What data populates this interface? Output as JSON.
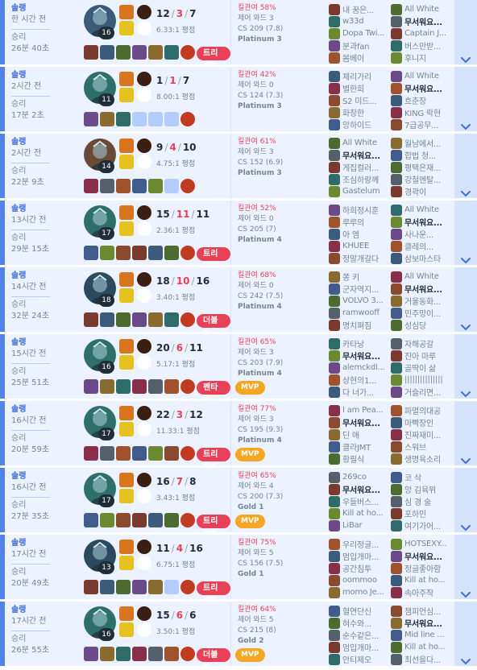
{
  "colors": {
    "win_bg": "#ecf2ff",
    "win_accent": "#5383e8",
    "loss_kda": "#e84057",
    "expand_bg": "#d5e3ff",
    "kill_badge": "#e84057",
    "mvp_badge": "#f5a623"
  },
  "icons": {
    "expand": "chevron-down-icon",
    "spell": "summoner-spell-icon",
    "rune": "rune-icon",
    "item": "item-icon",
    "ward": "trinket-icon",
    "champion": "champion-portrait"
  },
  "matches": [
    {
      "queue": "솔랭",
      "ago": "한 시간 전",
      "result": "승리",
      "length": "26분 40초",
      "level": "16",
      "k": "12",
      "d": "3",
      "a": "7",
      "ratio": "6.33:1 평점",
      "kp": "킬관여 58%",
      "wards": "제어 와드 3",
      "cs": "CS 209 (7.8)",
      "tier": "Platinum 3",
      "badge": "트리플킬",
      "mvp": "",
      "champ_color": "#3b5b7a",
      "empty_items": 0,
      "team1": [
        "내 꿈은...",
        "w33d",
        "Dopa Twi...",
        "분과fan",
        "봄베이"
      ],
      "team2": [
        "All White",
        "무서워요...",
        "Captain J...",
        "버스만받...",
        "후니지"
      ],
      "me_side": 2,
      "me_index": 1
    },
    {
      "queue": "솔랭",
      "ago": "2시간 전",
      "result": "승리",
      "length": "17분 2초",
      "level": "11",
      "k": "1",
      "d": "1",
      "a": "7",
      "ratio": "8.00:1 평점",
      "kp": "킬관여 42%",
      "wards": "제어 와드 0",
      "cs": "CS 124 (7.3)",
      "tier": "Platinum 3",
      "badge": "",
      "mvp": "",
      "champ_color": "#2f6f6a",
      "empty_items": 3,
      "team1": [
        "제리가리",
        "별한희",
        "S2 미드...",
        "화창한",
        "앙하이드"
      ],
      "team2": [
        "All White",
        "무서워요...",
        "흐춘장",
        "KING 락현",
        "7급공무..."
      ],
      "me_side": 2,
      "me_index": 1
    },
    {
      "queue": "솔랭",
      "ago": "2시간 전",
      "result": "승리",
      "length": "22분 9초",
      "level": "14",
      "k": "9",
      "d": "4",
      "a": "10",
      "ratio": "4.75:1 평점",
      "kp": "킬관여 61%",
      "wards": "제어 와드 3",
      "cs": "CS 152 (6.9)",
      "tier": "Platinum 3",
      "badge": "",
      "mvp": "",
      "champ_color": "#6a4a36",
      "empty_items": 1,
      "team1": [
        "All White",
        "무서워요...",
        "게집컬러...",
        "조심하랑께",
        "Gastelum"
      ],
      "team2": [
        "월남에서...",
        "합법 청...",
        "평택은재...",
        "강철멘탈...",
        "경곽이"
      ],
      "me_side": 1,
      "me_index": 1
    },
    {
      "queue": "솔랭",
      "ago": "13시간 전",
      "result": "승리",
      "length": "29분 15초",
      "level": "17",
      "k": "15",
      "d": "11",
      "a": "11",
      "ratio": "2.36:1 평점",
      "kp": "킬관여 52%",
      "wards": "제어 와드 0",
      "cs": "CS 205 (7)",
      "tier": "Platinum 4",
      "badge": "트리플킬",
      "mvp": "",
      "champ_color": "#2f6f6a",
      "empty_items": 0,
      "team1": [
        "하희정시훈",
        "루루의",
        "아 엠",
        "KHUEE",
        "정말개갈다"
      ],
      "team2": [
        "All White",
        "무서워요...",
        "사나운...",
        "클레의...",
        "삼보마스타"
      ],
      "me_side": 2,
      "me_index": 1
    },
    {
      "queue": "솔랭",
      "ago": "14시간 전",
      "result": "승리",
      "length": "32분 24초",
      "level": "18",
      "k": "18",
      "d": "10",
      "a": "16",
      "ratio": "3.40:1 평점",
      "kp": "킬관여 68%",
      "wards": "제어 와드 0",
      "cs": "CS 242 (7.5)",
      "tier": "Platinum 4",
      "badge": "더블킬",
      "mvp": "",
      "champ_color": "#2c4a5e",
      "empty_items": 0,
      "team1": [
        "쫑 키",
        "군자역지...",
        "VOLVO 3...",
        "ramwooff",
        "명치펴짐"
      ],
      "team2": [
        "All White",
        "무서워요...",
        "거울동화...",
        "민주망이...",
        "성심당"
      ],
      "me_side": 2,
      "me_index": 1
    },
    {
      "queue": "솔랭",
      "ago": "15시간 전",
      "result": "승리",
      "length": "25분 51초",
      "level": "16",
      "k": "20",
      "d": "6",
      "a": "11",
      "ratio": "5.17:1 평점",
      "kp": "킬관여 65%",
      "wards": "제어 와드 3",
      "cs": "CS 203 (7.9)",
      "tier": "Platinum 4",
      "badge": "펜타킬",
      "mvp": "MVP",
      "champ_color": "#2f6f6a",
      "empty_items": 0,
      "team1": [
        "카타낭",
        "무서워요...",
        "alemckdl...",
        "상현의1...",
        "다 너가..."
      ],
      "team2": [
        "자해공갈",
        "진아 마루",
        "골딱이 삶",
        "|||||||||||||||",
        "거슬리면..."
      ],
      "me_side": 1,
      "me_index": 1
    },
    {
      "queue": "솔랭",
      "ago": "16시간 전",
      "result": "승리",
      "length": "20분 59초",
      "level": "17",
      "k": "22",
      "d": "3",
      "a": "12",
      "ratio": "11.33:1 평점",
      "kp": "킬관여 77%",
      "wards": "제어 와드 3",
      "cs": "CS 195 (9.3)",
      "tier": "Platinum 4",
      "badge": "트리플킬",
      "mvp": "MVP",
      "champ_color": "#2f6f6a",
      "empty_items": 0,
      "team1": [
        "I am Pea...",
        "무서워요...",
        "딘 애",
        "클라JMT",
        "황필식"
      ],
      "team2": [
        "파멸의대공",
        "마빡장인",
        "진짜재미...",
        "스워브",
        "생명육소리"
      ],
      "me_side": 1,
      "me_index": 1
    },
    {
      "queue": "솔랭",
      "ago": "16시간 전",
      "result": "승리",
      "length": "27분 35초",
      "level": "17",
      "k": "16",
      "d": "7",
      "a": "8",
      "ratio": "3.43:1 평점",
      "kp": "킬관여 65%",
      "wards": "제어 와드 4",
      "cs": "CS 200 (7.3)",
      "tier": "Gold 1",
      "badge": "트리플킬",
      "mvp": "MVP",
      "champ_color": "#2f6f6a",
      "empty_items": 0,
      "team1": [
        "269co",
        "무서워요...",
        "우들버스...",
        "Kill at ho...",
        "LiBar"
      ],
      "team2": [
        "코 삭",
        "앙 김육뮈",
        "심 경 술",
        "포하민",
        "여기가어..."
      ],
      "me_side": 1,
      "me_index": 1
    },
    {
      "queue": "솔랭",
      "ago": "17시간 전",
      "result": "승리",
      "length": "20분 49초",
      "level": "13",
      "k": "11",
      "d": "4",
      "a": "16",
      "ratio": "6.75:1 평점",
      "kp": "킬관여 75%",
      "wards": "제어 와드 5",
      "cs": "CS 156 (7.5)",
      "tier": "Gold 1",
      "badge": "트리플킬",
      "mvp": "",
      "champ_color": "#2c4a5e",
      "empty_items": 1,
      "team1": [
        "우리정글...",
        "멈입개마...",
        "공간침투",
        "oommoo",
        "momo Je..."
      ],
      "team2": [
        "HOTSEXY...",
        "무서워요...",
        "정글좋아함",
        "Kill at ho...",
        "속아주작"
      ],
      "me_side": 2,
      "me_index": 1
    },
    {
      "queue": "솔랭",
      "ago": "17시간 전",
      "result": "승리",
      "length": "26분 55초",
      "level": "16",
      "k": "15",
      "d": "6",
      "a": "6",
      "ratio": "3.50:1 평점",
      "kp": "킬관여 64%",
      "wards": "제어 와드 5",
      "cs": "CS 215 (8)",
      "tier": "Gold 2",
      "badge": "더블킬",
      "mvp": "MVP",
      "champ_color": "#2f6f6a",
      "empty_items": 0,
      "team1": [
        "혈연단신",
        "혀수와...",
        "순수같은...",
        "멈입개마...",
        "안티제오"
      ],
      "team2": [
        "챔피언심...",
        "무서워요...",
        "Mid line ...",
        "Kill at ho...",
        "최선을다..."
      ],
      "me_side": 2,
      "me_index": 1
    }
  ]
}
